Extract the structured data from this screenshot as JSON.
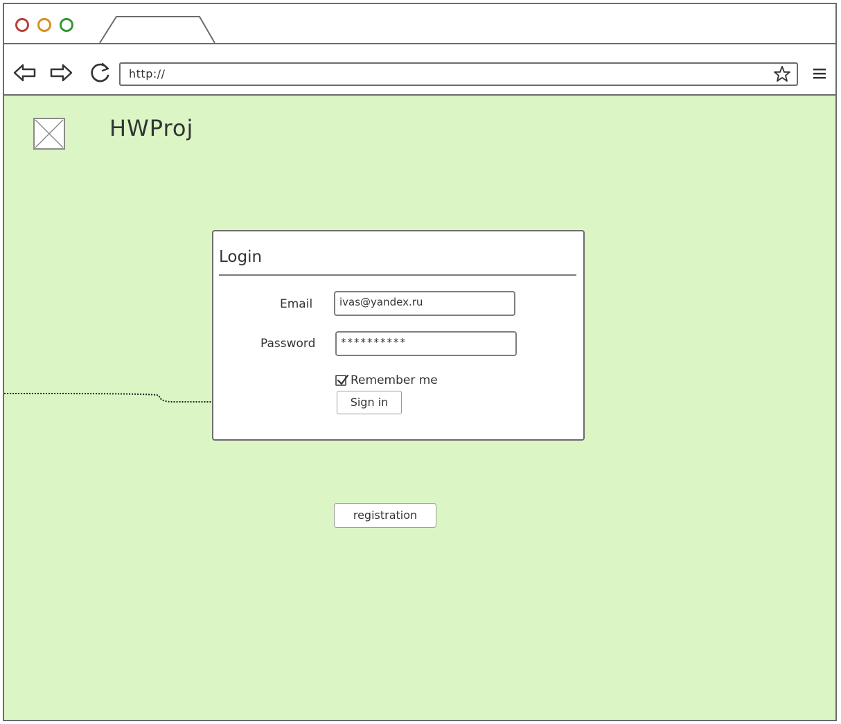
{
  "browser": {
    "url": "http://"
  },
  "header": {
    "brand": "HWProj"
  },
  "login": {
    "title": "Login",
    "email_label": "Email",
    "email_value": "ivas@yandex.ru",
    "password_label": "Password",
    "password_value": "**********",
    "remember_label": "Remember me",
    "remember_checked": true,
    "signin_label": "Sign in"
  },
  "footer_actions": {
    "registration_label": "registration"
  },
  "colors": {
    "content_background": "#dbf5c5",
    "border": "#6b6b6b",
    "traffic_red": "#b8403a",
    "traffic_orange": "#d8901e",
    "traffic_green": "#2f9a2f"
  },
  "icons": {
    "back": "back-arrow-icon",
    "forward": "forward-arrow-icon",
    "reload": "reload-icon",
    "bookmark": "star-icon",
    "menu": "hamburger-menu-icon",
    "logo": "image-placeholder-icon",
    "checkbox": "check-icon"
  }
}
